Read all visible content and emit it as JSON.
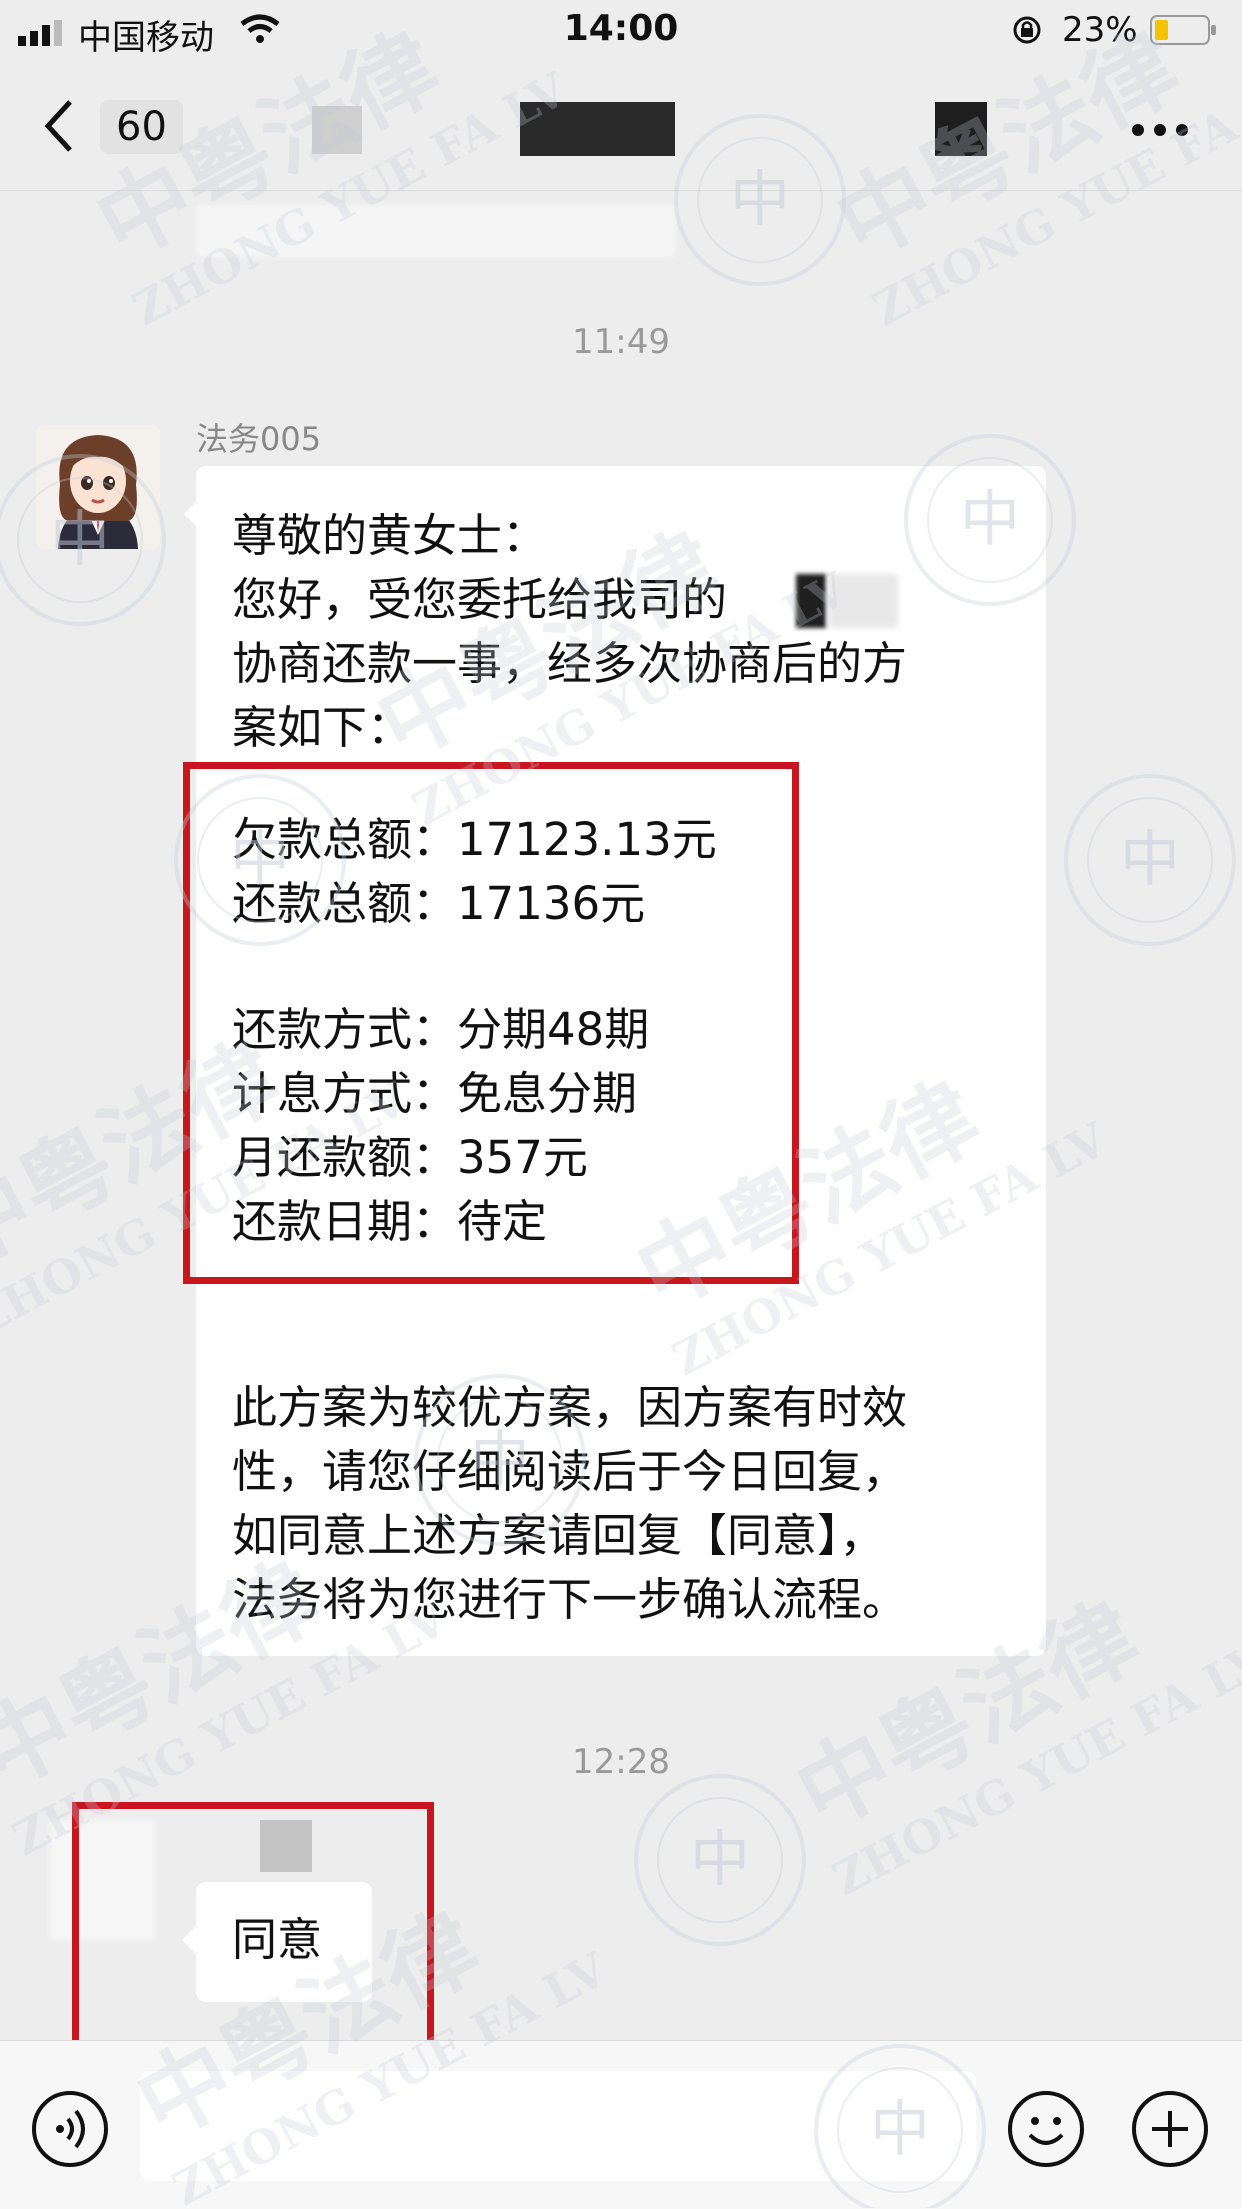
{
  "status_bar": {
    "carrier": "中国移动",
    "time": "14:00",
    "battery": "23%"
  },
  "nav": {
    "back_count": "60"
  },
  "chat": {
    "time_1": "11:49",
    "sender_name": "法务005",
    "message_lines": [
      "尊敬的黄女士：",
      "您好，受您委托给我司的",
      "协商还款一事，经多次协商后的方",
      "案如下：",
      "欠款总额：17123.13元",
      "还款总额：17136元",
      "还款方式：分期48期",
      "计息方式：免息分期",
      "月还款额：357元",
      "还款日期：待定",
      "此方案为较优方案，因方案有时效",
      "性，请您仔细阅读后于今日回复，",
      "如同意上述方案请回复【同意】，",
      "法务将为您进行下一步确认流程。"
    ],
    "time_2": "12:28",
    "reply_text": "同意"
  },
  "watermark": {
    "brand_cn": "中粤法律",
    "brand_en": "ZHONG YUE FA LV",
    "seal_glyph": "中"
  },
  "colors": {
    "background": "#ededed",
    "bubble": "#ffffff",
    "highlight_box": "#c8161d",
    "battery_fill": "#f5c400"
  },
  "icons": [
    "signal-icon",
    "wifi-icon",
    "rotation-lock-icon",
    "battery-icon",
    "back-chevron-icon",
    "more-icon",
    "voice-icon",
    "emoji-icon",
    "plus-icon"
  ]
}
